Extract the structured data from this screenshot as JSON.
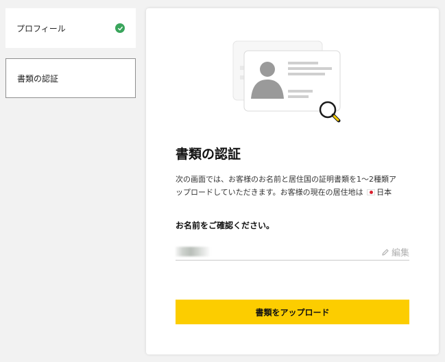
{
  "sidebar": {
    "steps": [
      {
        "label": "プロフィール",
        "status": "completed"
      },
      {
        "label": "書類の認証",
        "status": "active"
      }
    ]
  },
  "main": {
    "title": "書類の認証",
    "description_line1": "次の画面では、お客様のお名前と居住国の証明書類を1～2種類ア",
    "description_line2_prefix": "ップロードしていただきます。お客様の現在の居住地は",
    "country": "日本",
    "confirm_heading": "お名前をご確認ください。",
    "edit_label": "編集",
    "upload_button_label": "書類をアップロード"
  },
  "colors": {
    "accent": "#fccd00",
    "success": "#3aa55c",
    "background": "#f2f2f2"
  }
}
